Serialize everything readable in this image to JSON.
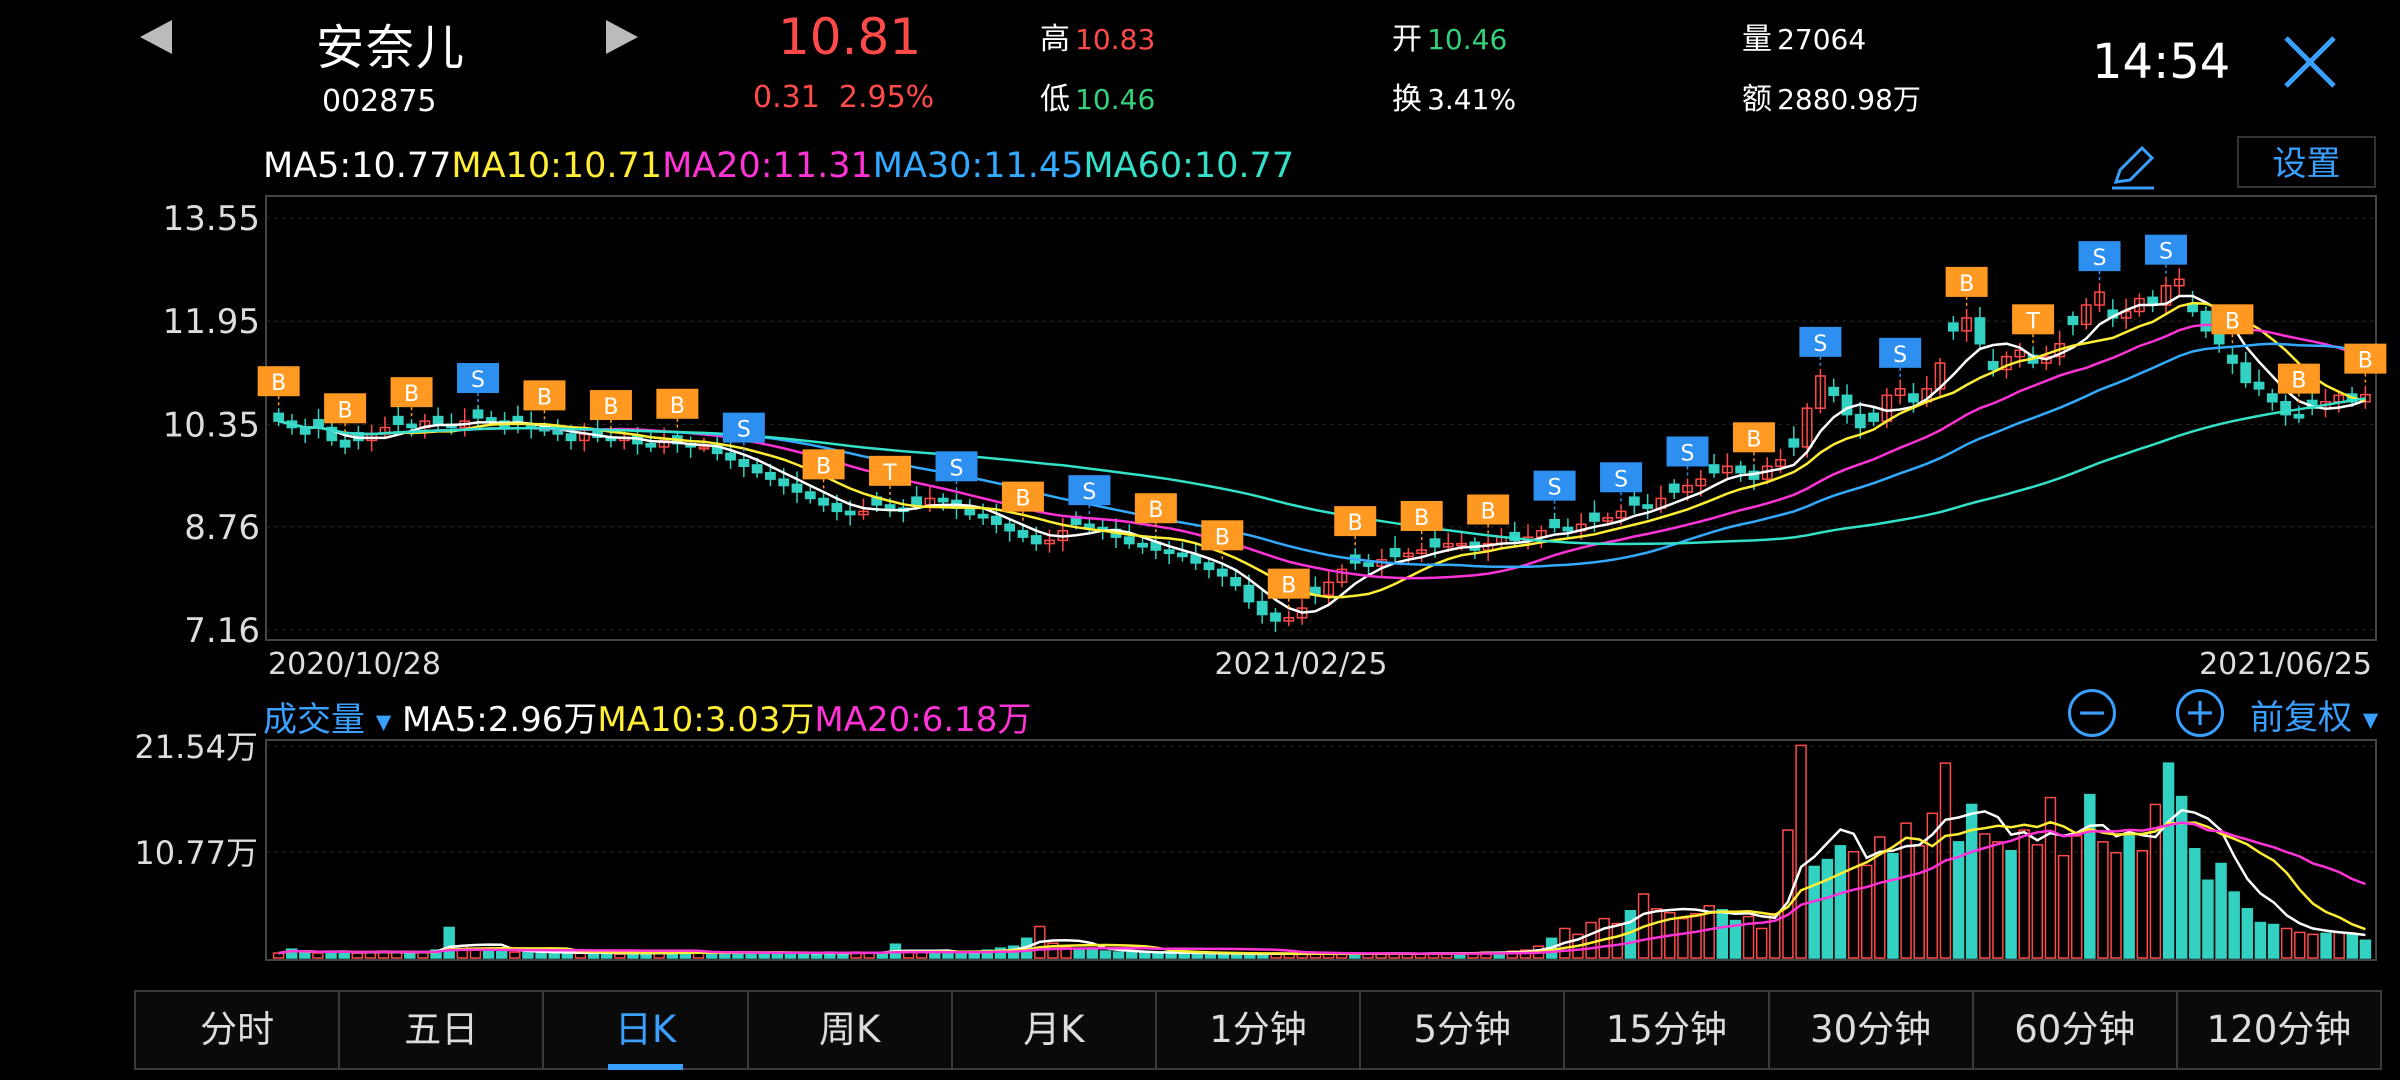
{
  "header": {
    "stock_name": "安奈儿",
    "stock_code": "002875",
    "price": "10.81",
    "change": "0.31",
    "change_pct": "2.95%",
    "high_label": "高",
    "high_value": "10.83",
    "low_label": "低",
    "low_value": "10.46",
    "open_label": "开",
    "open_value": "10.46",
    "turnover_label": "换",
    "turnover_value": "3.41%",
    "volume_label": "量",
    "volume_value": "27064",
    "amount_label": "额",
    "amount_value": "2880.98万",
    "time": "14:54"
  },
  "colors": {
    "up": "#ff4a4a",
    "down": "#33d1c2",
    "accent": "#3aa0ff",
    "ma5": "#ffffff",
    "ma10": "#ffee33",
    "ma20": "#ff33d6",
    "ma30": "#33aaff",
    "ma60": "#33e0c8",
    "buy_marker": "#ff9922",
    "sell_marker": "#2d8ff0"
  },
  "ma_legend": [
    {
      "label": "MA5:10.77",
      "color": "#ffffff"
    },
    {
      "label": "MA10:10.71",
      "color": "#ffee33"
    },
    {
      "label": "MA20:11.31",
      "color": "#ff33d6"
    },
    {
      "label": "MA30:11.45",
      "color": "#33aaff"
    },
    {
      "label": "MA60:10.77",
      "color": "#33e0c8"
    }
  ],
  "settings_label": "设置",
  "volume_legend": {
    "title": "成交量",
    "items": [
      {
        "label": "MA5:2.96万",
        "color": "#ffffff"
      },
      {
        "label": "MA10:3.03万",
        "color": "#ffee33"
      },
      {
        "label": "MA20:6.18万",
        "color": "#ff33d6"
      }
    ]
  },
  "zoom_out_label": "−",
  "zoom_in_label": "+",
  "adjust_label": "前复权",
  "tabs": [
    "分时",
    "五日",
    "日K",
    "周K",
    "月K",
    "1分钟",
    "5分钟",
    "15分钟",
    "30分钟",
    "60分钟",
    "120分钟"
  ],
  "active_tab": "日K",
  "chart_data": [
    {
      "type": "candlestick",
      "y_ticks": [
        "13.55",
        "11.95",
        "10.35",
        "8.76",
        "7.16"
      ],
      "ylim": [
        7.16,
        13.55
      ],
      "x_labels": [
        "2020/10/28",
        "2021/02/25",
        "2021/06/25"
      ],
      "close": [
        10.4,
        10.3,
        10.2,
        10.3,
        10.1,
        10.0,
        10.1,
        10.2,
        10.3,
        10.35,
        10.3,
        10.4,
        10.35,
        10.3,
        10.4,
        10.45,
        10.4,
        10.3,
        10.35,
        10.3,
        10.25,
        10.2,
        10.1,
        10.2,
        10.15,
        10.1,
        10.15,
        10.05,
        10.0,
        10.1,
        10.05,
        10.0,
        10.0,
        9.9,
        9.8,
        9.7,
        9.6,
        9.5,
        9.4,
        9.3,
        9.2,
        9.1,
        9.0,
        8.95,
        9.0,
        9.1,
        9.05,
        9.0,
        9.1,
        9.2,
        9.15,
        9.05,
        8.95,
        8.9,
        8.8,
        8.7,
        8.6,
        8.5,
        8.55,
        8.7,
        8.8,
        8.75,
        8.7,
        8.6,
        8.5,
        8.45,
        8.4,
        8.35,
        8.3,
        8.2,
        8.1,
        8.0,
        7.85,
        7.6,
        7.4,
        7.3,
        7.35,
        7.5,
        7.7,
        7.9,
        8.1,
        8.2,
        8.15,
        8.25,
        8.3,
        8.35,
        8.4,
        8.45,
        8.5,
        8.5,
        8.4,
        8.5,
        8.6,
        8.55,
        8.6,
        8.7,
        8.75,
        8.7,
        8.8,
        8.85,
        8.9,
        9.0,
        9.1,
        9.05,
        9.2,
        9.3,
        9.4,
        9.5,
        9.6,
        9.7,
        9.6,
        9.5,
        9.7,
        9.8,
        10.0,
        10.6,
        11.1,
        10.8,
        10.5,
        10.3,
        10.4,
        10.8,
        10.9,
        10.7,
        10.9,
        11.3,
        11.8,
        12.0,
        11.6,
        11.2,
        11.4,
        11.5,
        11.3,
        11.4,
        11.6,
        11.9,
        12.2,
        12.4,
        12.0,
        12.1,
        12.3,
        12.2,
        12.5,
        12.6,
        12.1,
        11.8,
        11.6,
        11.3,
        11.0,
        10.9,
        10.7,
        10.5,
        10.45,
        10.6,
        10.7,
        10.8,
        10.7,
        10.81
      ],
      "buy_sell_markers": [
        "B",
        "B",
        "B",
        "S",
        "B",
        "B",
        "B",
        "S",
        "B",
        "T",
        "S",
        "B",
        "S",
        "B",
        "B",
        "B",
        "B",
        "B",
        "B",
        "S",
        "S",
        "S",
        "B",
        "S",
        "S",
        "B",
        "T",
        "S",
        "S",
        "B",
        "B",
        "B"
      ],
      "ma5_last": 10.77,
      "ma10_last": 10.71,
      "ma20_last": 11.31,
      "ma30_last": 11.45,
      "ma60_last": 10.77
    },
    {
      "type": "bar",
      "title": "成交量",
      "y_ticks": [
        "21.54万",
        "10.77万"
      ],
      "ylim": [
        0,
        21.54
      ],
      "volumes_wan": [
        0.5,
        0.9,
        0.6,
        0.5,
        0.7,
        0.6,
        0.5,
        0.6,
        0.7,
        0.6,
        0.5,
        0.6,
        0.8,
        3.1,
        1.2,
        0.9,
        0.8,
        0.7,
        0.6,
        0.6,
        0.5,
        0.6,
        0.5,
        0.5,
        0.6,
        0.5,
        0.4,
        0.5,
        0.5,
        0.6,
        0.5,
        0.7,
        0.6,
        0.5,
        0.6,
        0.5,
        0.6,
        0.5,
        0.6,
        0.5,
        0.4,
        0.5,
        0.6,
        0.5,
        0.6,
        0.5,
        0.5,
        1.4,
        0.7,
        0.6,
        0.5,
        0.6,
        0.5,
        0.6,
        0.8,
        1.0,
        1.2,
        2.0,
        3.2,
        1.5,
        1.1,
        0.9,
        0.8,
        0.7,
        0.6,
        0.6,
        0.5,
        0.5,
        0.6,
        0.5,
        0.5,
        0.4,
        0.4,
        0.5,
        0.4,
        0.4,
        0.5,
        0.4,
        0.4,
        0.5,
        0.4,
        0.4,
        0.5,
        0.4,
        0.5,
        0.5,
        0.4,
        0.4,
        0.5,
        0.5,
        0.5,
        0.5,
        0.6,
        0.6,
        0.7,
        0.8,
        1.2,
        2.0,
        3.0,
        2.4,
        3.6,
        4.0,
        3.5,
        4.8,
        6.5,
        5.0,
        4.6,
        4.0,
        4.5,
        5.3,
        4.9,
        3.8,
        4.2,
        3.0,
        4.5,
        13.0,
        21.6,
        9.3,
        10.0,
        11.4,
        10.8,
        9.4,
        12.3,
        10.6,
        13.7,
        11.4,
        14.7,
        19.8,
        11.8,
        15.6,
        12.6,
        11.8,
        10.9,
        13.0,
        11.5,
        16.3,
        10.4,
        12.4,
        16.6,
        11.8,
        10.7,
        12.4,
        10.9,
        15.6,
        19.8,
        16.4,
        11.1,
        7.9,
        9.6,
        6.7,
        5.0,
        3.6,
        3.4,
        3.0,
        2.6,
        2.4,
        2.5,
        2.6,
        2.4,
        1.8
      ]
    }
  ]
}
